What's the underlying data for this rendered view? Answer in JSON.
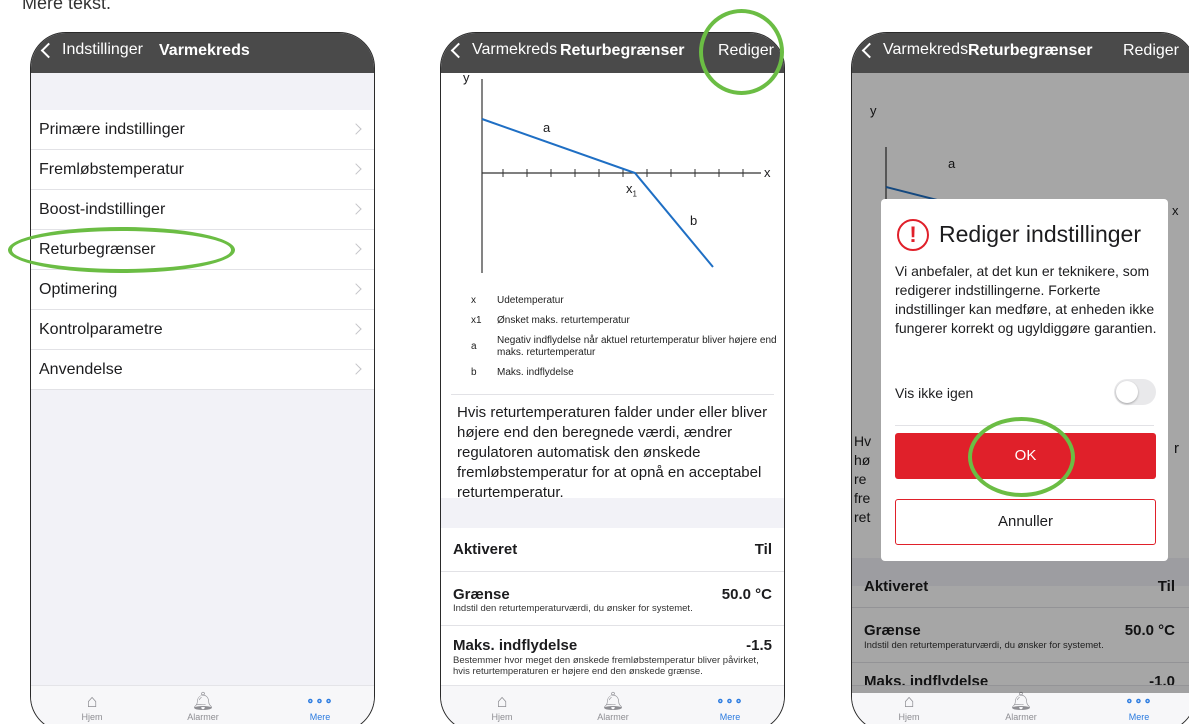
{
  "colors": {
    "navbar": "#4a4a4a",
    "accent_blue": "#2b7be0",
    "danger_red": "#e0202a",
    "highlight_green": "#6bbd44"
  },
  "top_cut_text": "Mere tekst.",
  "tabbar": {
    "home": "Hjem",
    "alarms": "Alarmer",
    "more": "Mere"
  },
  "screen1": {
    "back_label": "Indstillinger",
    "title": "Varmekreds",
    "items": [
      "Primære indstillinger",
      "Fremløbstemperatur",
      "Boost-indstillinger",
      "Returbegrænser",
      "Optimering",
      "Kontrolparametre",
      "Anvendelse"
    ],
    "highlighted_item": "Returbegrænser"
  },
  "screen2": {
    "back_label": "Varmekreds",
    "title": "Returbegrænser",
    "edit_label": "Rediger",
    "diagram_labels": {
      "y": "y",
      "x": "x",
      "a": "a",
      "b": "b",
      "x1": "x",
      "x1_sub": "1"
    },
    "legend": [
      {
        "key": "x",
        "text": "Udetemperatur"
      },
      {
        "key": "x1",
        "text": "Ønsket maks. returtemperatur"
      },
      {
        "key": "a",
        "text": "Negativ indflydelse når aktuel returtemperatur bliver højere end maks. returtemperatur"
      },
      {
        "key": "b",
        "text": "Maks. indflydelse"
      }
    ],
    "description": "Hvis returtemperaturen falder under eller bliver højere end den beregnede værdi, ændrer regulatoren automatisk den ønskede fremløbstemperatur for at opnå en acceptabel returtemperatur.",
    "activated_label": "Aktiveret",
    "activated_value": "Til",
    "limit_label": "Grænse",
    "limit_value": "50.0 °C",
    "limit_desc": "Indstil den returtemperaturværdi, du ønsker for systemet.",
    "max_influence_label": "Maks. indflydelse",
    "max_influence_value": "-1.5",
    "max_influence_desc": "Bestemmer hvor meget den ønskede fremløbstemperatur bliver påvirket, hvis returtemperaturen er højere end den ønskede grænse."
  },
  "screen3": {
    "back_label": "Varmekreds",
    "title": "Returbegrænser",
    "edit_label": "Rediger",
    "bg_desc_fragments": [
      "Hv",
      "hø",
      "re",
      "fre",
      "ret"
    ],
    "bg_right_fragments": [
      "x",
      "r"
    ],
    "activated_label": "Aktiveret",
    "activated_value": "Til",
    "limit_label": "Grænse",
    "limit_value": "50.0 °C",
    "limit_desc": "Indstil den returtemperaturværdi, du ønsker for systemet.",
    "max_influence_label": "Maks. indflydelse",
    "max_influence_value": "-1.0",
    "dialog": {
      "icon": "!",
      "title": "Rediger indstillinger",
      "body": "Vi anbefaler, at det kun er teknikere, som redigerer indstillingerne. Forkerte indstillinger kan medføre, at enheden ikke fungerer korrekt og ugyldiggøre garantien.",
      "checkbox_label": "Vis ikke igen",
      "ok_label": "OK",
      "cancel_label": "Annuller"
    }
  }
}
